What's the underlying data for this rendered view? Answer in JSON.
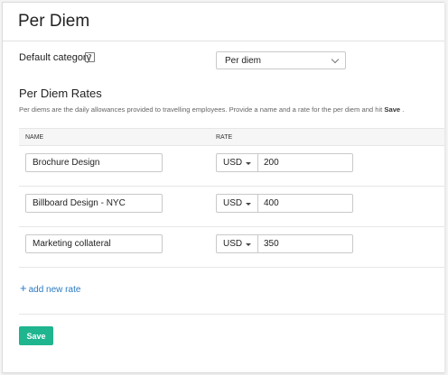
{
  "page": {
    "title": "Per Diem"
  },
  "default_category": {
    "label": "Default category",
    "help_icon": "calendar-help-icon",
    "help_glyph": "?",
    "selected": "Per diem"
  },
  "rates_section": {
    "title": "Per Diem Rates",
    "description": "Per diems are the daily allowances provided to travelling employees. Provide a name and a rate for the per diem and hit",
    "description_emphasis": "Save",
    "description_end": ".",
    "columns": {
      "name": "NAME",
      "rate": "RATE"
    },
    "rows": [
      {
        "name": "Brochure Design",
        "currency": "USD",
        "rate": "200"
      },
      {
        "name": "Billboard Design - NYC",
        "currency": "USD",
        "rate": "400"
      },
      {
        "name": "Marketing collateral",
        "currency": "USD",
        "rate": "350"
      }
    ],
    "add_label": "add new rate",
    "add_glyph": "+"
  },
  "actions": {
    "save_label": "Save"
  },
  "colors": {
    "accent": "#1fb58f",
    "link": "#2a7bc3"
  }
}
